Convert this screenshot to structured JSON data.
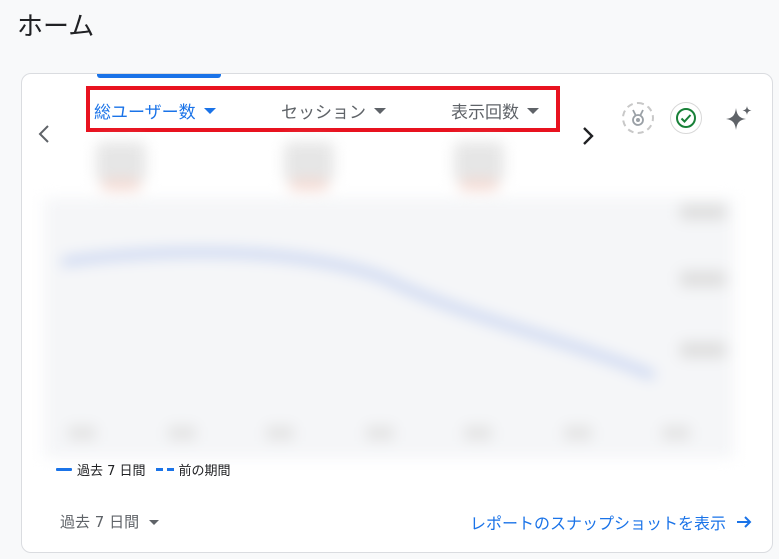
{
  "page": {
    "title": "ホーム"
  },
  "card": {
    "metrics": [
      {
        "label": "総ユーザー数",
        "active": true
      },
      {
        "label": "セッション",
        "active": false
      },
      {
        "label": "表示回数",
        "active": false
      }
    ],
    "legend": {
      "current": "過去 7 日間",
      "previous": "前の期間"
    },
    "date_range": {
      "selected": "過去 7 日間"
    },
    "report_link": {
      "label": "レポートのスナップショットを表示"
    }
  },
  "colors": {
    "accent": "#1a73e8",
    "highlight": "#e8121f",
    "check": "#188038"
  },
  "icons": [
    "chevron-left-icon",
    "chevron-right-icon",
    "medal-icon",
    "check-circle-icon",
    "sparkle-icon",
    "arrow-right-icon"
  ]
}
